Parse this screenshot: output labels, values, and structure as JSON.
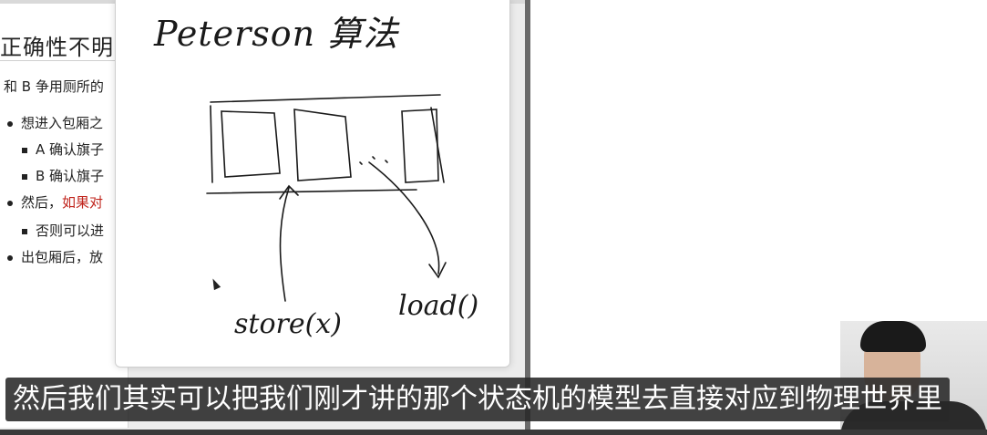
{
  "slide": {
    "title": "正确性不明",
    "intro": "和 B 争用厕所的",
    "items": [
      {
        "level": 1,
        "text": "想进入包厢之"
      },
      {
        "level": 2,
        "text": "A 确认旗子"
      },
      {
        "level": 2,
        "text": "B 确认旗子"
      },
      {
        "level": 1,
        "text_prefix": "然后，",
        "text_red": "如果对"
      },
      {
        "level": 2,
        "text": "否则可以进"
      },
      {
        "level": 1,
        "text": "出包厢后，放"
      }
    ]
  },
  "board": {
    "title": "Peterson 算法",
    "label_store": "store(x)",
    "label_load": "load()"
  },
  "subtitle": "然后我们其实可以把我们刚才讲的那个状态机的模型去直接对应到物理世界里",
  "colors": {
    "accent_red": "#c0241c",
    "subtitle_bg": "#282828"
  }
}
